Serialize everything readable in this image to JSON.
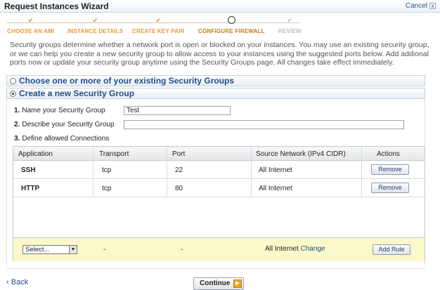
{
  "window": {
    "title": "Request Instances Wizard",
    "cancel_label": "Cancel",
    "close_glyph": "x"
  },
  "steps": [
    {
      "label": "CHOOSE AN AMI",
      "state": "done"
    },
    {
      "label": "INSTANCE DETAILS",
      "state": "done"
    },
    {
      "label": "CREATE KEY PAIR",
      "state": "done"
    },
    {
      "label": "CONFIGURE FIREWALL",
      "state": "current"
    },
    {
      "label": "REVIEW",
      "state": "future"
    }
  ],
  "intro": "Security groups determine whether a network port is open or blocked on your instances. You may use an existing security group, or we can help you create a new security group to allow access to your instances using the suggested ports below. Add addional ports now or update your security group anytime using the Security Groups page. All changes take effect immediately.",
  "options": {
    "existing": {
      "label": "Choose one or more of your existing Security Groups",
      "selected": false
    },
    "create": {
      "label": "Create a new Security Group",
      "selected": true
    }
  },
  "form": {
    "name": {
      "number": "1.",
      "label": "Name your Security Group",
      "value": "Test"
    },
    "description": {
      "number": "2.",
      "label": "Describe your Security Group",
      "value": ""
    },
    "connections": {
      "number": "3.",
      "label": "Define allowed Connections"
    }
  },
  "table": {
    "headers": [
      "Application",
      "Transport",
      "Port",
      "Source Network (IPv4 CIDR)",
      "Actions"
    ],
    "rows": [
      {
        "application": "SSH",
        "transport": "tcp",
        "port": "22",
        "source": "All Internet",
        "action": "Remove"
      },
      {
        "application": "HTTP",
        "transport": "tcp",
        "port": "80",
        "source": "All Internet",
        "action": "Remove"
      }
    ],
    "add_row": {
      "select_value": "Select...",
      "transport": "-",
      "port": "-",
      "source": "All Internet",
      "change_label": "Change",
      "add_label": "Add Rule"
    }
  },
  "footer": {
    "back_label": "Back",
    "back_glyph": "‹",
    "continue_label": "Continue"
  },
  "colors": {
    "accent_orange": "#e39a3c",
    "link_blue": "#1f4e8c",
    "add_row_bg": "#fbf9c9"
  }
}
